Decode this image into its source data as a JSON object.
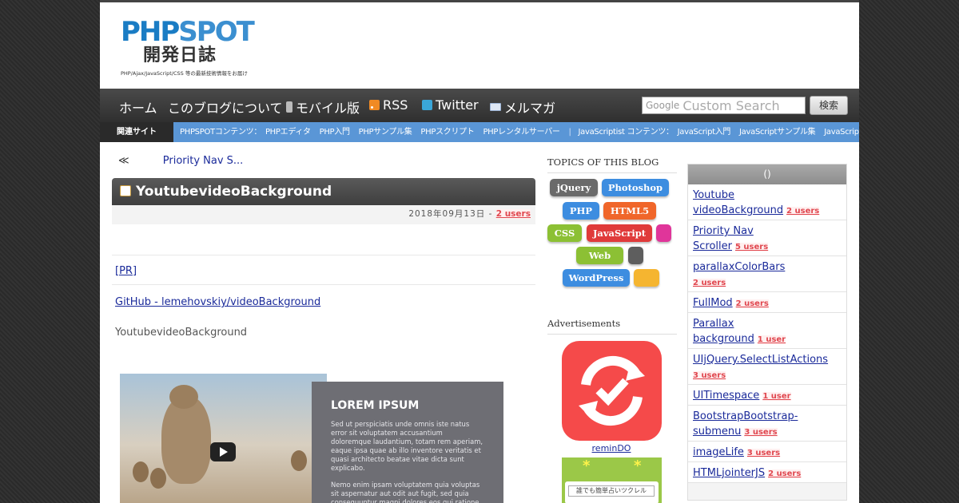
{
  "header": {
    "logo_php": "PHP",
    "logo_spot": "SPOT",
    "logo_sub": "開発日誌",
    "logo_tagline": "PHP/Ajax/JavaScript/CSS 等の最新技術情報をお届け"
  },
  "nav": {
    "items": [
      {
        "label": "ホーム",
        "icon": ""
      },
      {
        "label": "このブログについて",
        "icon": ""
      },
      {
        "label": "モバイル版",
        "icon": "mobile-icon"
      },
      {
        "label": "RSS",
        "icon": "rss-icon"
      },
      {
        "label": "Twitter",
        "icon": "twitter-icon"
      },
      {
        "label": "メルマガ",
        "icon": "mail-icon"
      }
    ],
    "search_prefix": "Google",
    "search_placeholder": "Custom Search",
    "search_button": "検索"
  },
  "related": {
    "label": "関連サイト",
    "php_group": "PHPSPOTコンテンツ：",
    "php_links": [
      "PHPエディタ",
      "PHP入門",
      "PHPサンプル集",
      "PHPスクリプト",
      "PHPレンタルサーバー"
    ],
    "js_group": "JavaScriptist コンテンツ：",
    "js_links": [
      "JavaScript入門",
      "JavaScriptサンプル集",
      "JavaScriptリファレンス"
    ]
  },
  "post": {
    "prev_symbol": "≪",
    "prev_title": "Priority Nav S...",
    "title": "YoutubevideoBackground",
    "date": "2018年09月13日",
    "meta_sep": "-",
    "users": "2 users",
    "pr_link": "[PR]",
    "github_link": "GitHub - lemehovskiy/videoBackground",
    "description": "YoutubevideoBackground",
    "preview_title": "LOREM IPSUM",
    "preview_p1": "Sed ut perspiciatis unde omnis iste natus error sit voluptatem accusantium doloremque laudantium, totam rem aperiam, eaque ipsa quae ab illo inventore veritatis et quasi architecto beatae vitae dicta sunt explicabo.",
    "preview_p2": "Nemo enim ipsam voluptatem quia voluptas sit aspernatur aut odit aut fugit, sed quia consequuntur magni dolores eos qui ratione voluptatem sequi nesciunt."
  },
  "topics": {
    "heading": "TOPICS OF THIS BLOG",
    "tags": [
      {
        "label": "jQuery",
        "color": "#6a6a6a"
      },
      {
        "label": "Photoshop",
        "color": "#3d8de0"
      },
      {
        "label": "PHP",
        "color": "#3d8de0"
      },
      {
        "label": "HTML5",
        "color": "#f0662a"
      },
      {
        "label": "CSS",
        "color": "#8cc034"
      },
      {
        "label": "JavaScript",
        "color": "#e03a3a"
      },
      {
        "label": "",
        "color": "#e0359a"
      },
      {
        "label": "Web",
        "color": "#8cc034"
      },
      {
        "label": "",
        "color": "#5e5e5e"
      },
      {
        "label": "WordPress",
        "color": "#3d8de0"
      },
      {
        "label": "",
        "color": "#f5b530"
      }
    ]
  },
  "ads": {
    "heading": "Advertisements",
    "app_name": "reminDO",
    "app2_text": "誰でも簡単占いツクレル"
  },
  "sidebar": {
    "heading": "()",
    "items": [
      {
        "title_line1": "Youtube",
        "title_line2": "videoBackground",
        "users": "2 users"
      },
      {
        "title_line1": "Priority Nav",
        "title_line2": "Scroller",
        "users": "5 users"
      },
      {
        "title_line1": "parallaxColorBars",
        "title_line2": "",
        "users": "2 users"
      },
      {
        "title_line1": "FullMod",
        "title_line2": "",
        "users": "2 users"
      },
      {
        "title_line1": "Parallax",
        "title_line2": "background",
        "users": "1 user"
      },
      {
        "title_line1": "UIjQuery.SelectListActions",
        "title_line2": "",
        "users": "3 users"
      },
      {
        "title_line1": "UITimespace",
        "title_line2": "",
        "users": "1 user"
      },
      {
        "title_line1": "BootstrapBootstrap-",
        "title_line2": "submenu",
        "users": "3 users"
      },
      {
        "title_line1": "imageLife",
        "title_line2": "",
        "users": "3 users"
      },
      {
        "title_line1": "HTMLjointerJS",
        "title_line2": "",
        "users": "2 users"
      }
    ]
  }
}
